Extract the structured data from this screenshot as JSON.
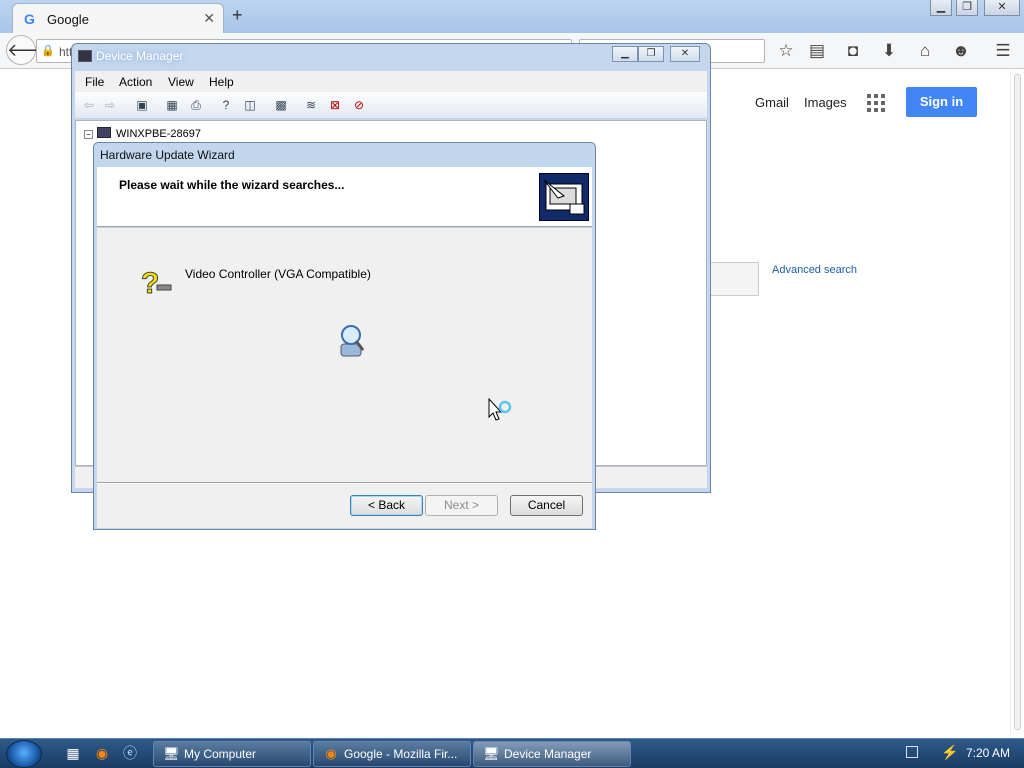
{
  "browser": {
    "tab_title": "Google",
    "tab_icon": "G",
    "url_partial": "htt",
    "brand_color": "#4285f4"
  },
  "google": {
    "gmail": "Gmail",
    "images": "Images",
    "sign_in": "Sign in",
    "advanced_search": "Advanced search"
  },
  "device_manager": {
    "title": "Device Manager",
    "menu": [
      "File",
      "Action",
      "View",
      "Help"
    ],
    "tree_root": "WINXPBE-28697"
  },
  "wizard": {
    "title": "Hardware Update Wizard",
    "heading": "Please wait while the wizard searches...",
    "device_name": "Video Controller (VGA Compatible)",
    "back_label": "< Back",
    "next_label": "Next >",
    "cancel_label": "Cancel"
  },
  "taskbar": {
    "items": [
      {
        "label": "My Computer",
        "icon": "computer-icon"
      },
      {
        "label": "Google - Mozilla Fir...",
        "icon": "firefox-icon"
      },
      {
        "label": "Device Manager",
        "icon": "device-manager-icon"
      }
    ],
    "clock": "7:20 AM"
  }
}
